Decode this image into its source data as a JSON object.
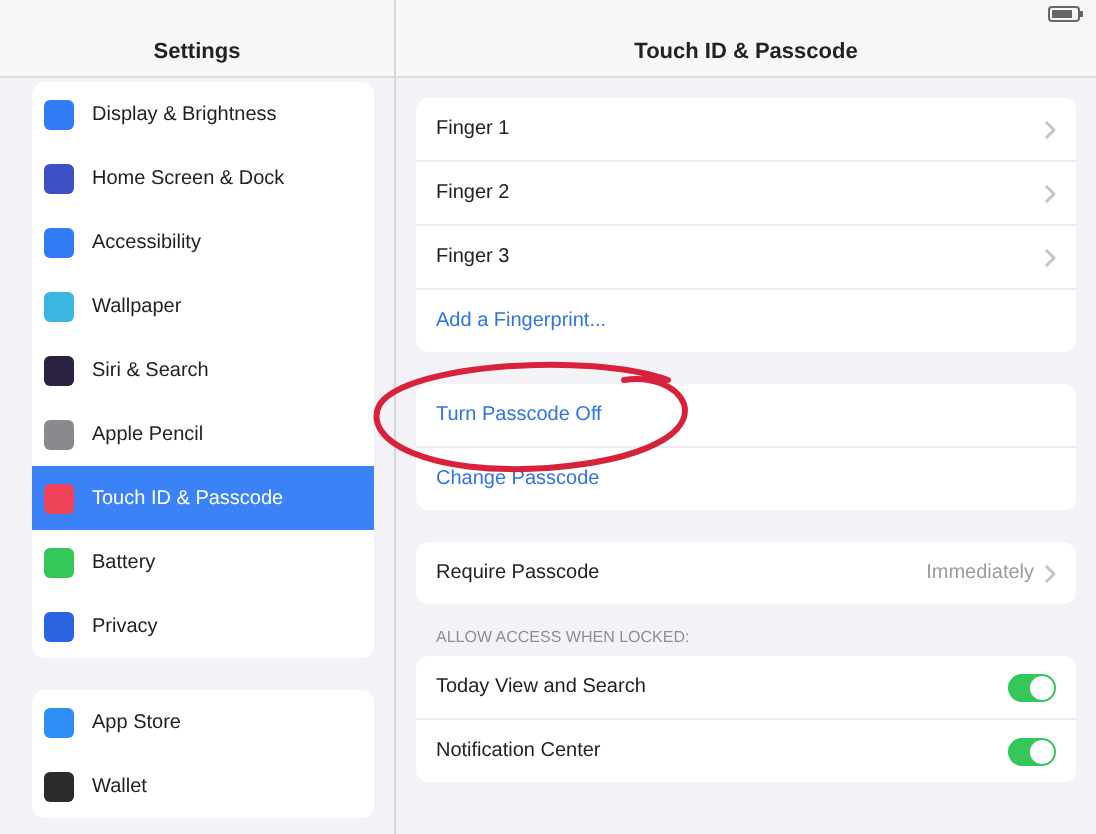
{
  "sidebar": {
    "title": "Settings",
    "groups": [
      {
        "items": [
          {
            "label": "Display & Brightness",
            "color": "#2f7cf6",
            "selected": false
          },
          {
            "label": "Home Screen & Dock",
            "color": "#3c4fc4",
            "selected": false
          },
          {
            "label": "Accessibility",
            "color": "#2f7cf6",
            "selected": false
          },
          {
            "label": "Wallpaper",
            "color": "#3bb6e0",
            "selected": false
          },
          {
            "label": "Siri & Search",
            "color": "#2b2140",
            "selected": false
          },
          {
            "label": "Apple Pencil",
            "color": "#8a8a8e",
            "selected": false
          },
          {
            "label": "Touch ID & Passcode",
            "color": "#f0445a",
            "selected": true
          },
          {
            "label": "Battery",
            "color": "#34c759",
            "selected": false
          },
          {
            "label": "Privacy",
            "color": "#2a64e0",
            "selected": false
          }
        ]
      },
      {
        "items": [
          {
            "label": "App Store",
            "color": "#2f8ef6",
            "selected": false
          },
          {
            "label": "Wallet",
            "color": "#2b2b2b",
            "selected": false
          }
        ]
      }
    ]
  },
  "detail": {
    "title": "Touch ID & Passcode",
    "groups": [
      {
        "rows": [
          {
            "kind": "nav",
            "label": "Finger 1"
          },
          {
            "kind": "nav",
            "label": "Finger 2"
          },
          {
            "kind": "nav",
            "label": "Finger 3"
          },
          {
            "kind": "action",
            "label": "Add a Fingerprint..."
          }
        ]
      },
      {
        "annotated": true,
        "rows": [
          {
            "kind": "action",
            "label": "Turn Passcode Off"
          },
          {
            "kind": "action",
            "label": "Change Passcode"
          }
        ]
      },
      {
        "rows": [
          {
            "kind": "nav",
            "label": "Require Passcode",
            "value": "Immediately"
          }
        ]
      },
      {
        "header": "ALLOW ACCESS WHEN LOCKED:",
        "rows": [
          {
            "kind": "toggle",
            "label": "Today View and Search",
            "on": true
          },
          {
            "kind": "toggle",
            "label": "Notification Center",
            "on": true
          }
        ]
      }
    ]
  }
}
